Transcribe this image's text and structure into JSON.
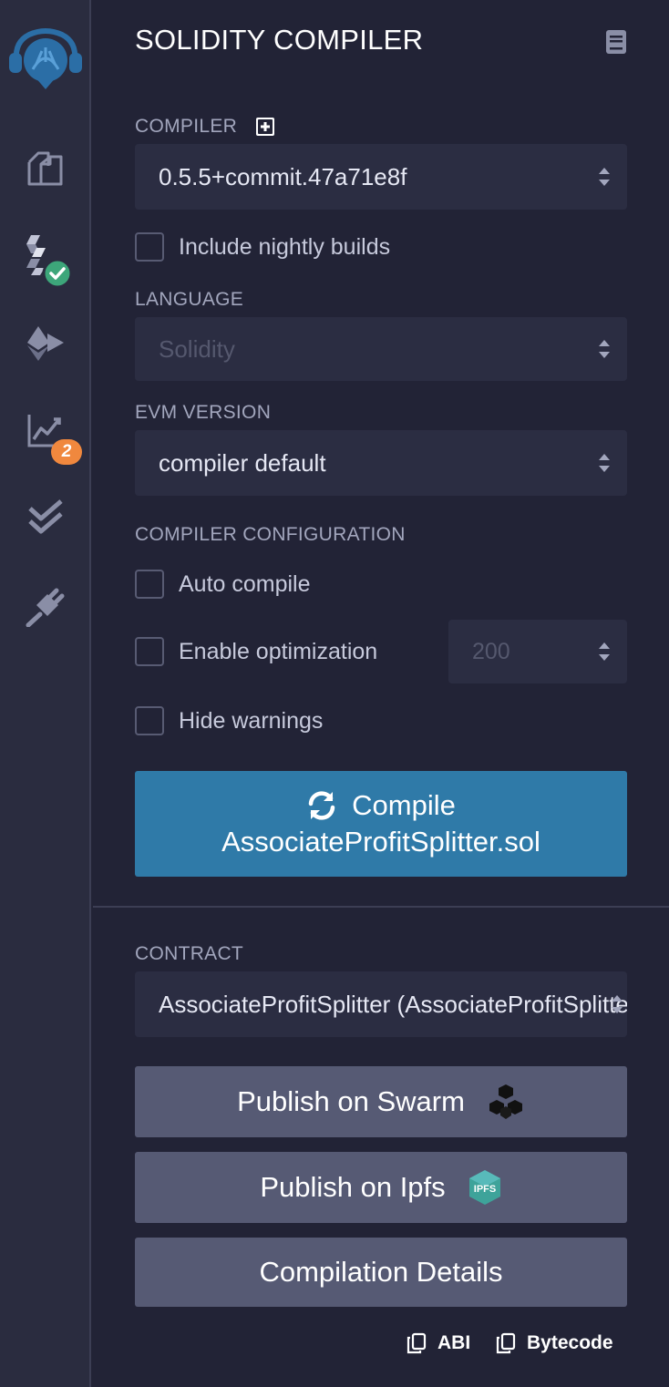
{
  "title": "SOLIDITY COMPILER",
  "compiler": {
    "label": "COMPILER",
    "version": "0.5.5+commit.47a71e8f",
    "nightly_label": "Include nightly builds"
  },
  "language": {
    "label": "LANGUAGE",
    "value": "Solidity"
  },
  "evm": {
    "label": "EVM VERSION",
    "value": "compiler default"
  },
  "config": {
    "label": "COMPILER CONFIGURATION",
    "auto_compile": "Auto compile",
    "optimization": "Enable optimization",
    "runs": "200",
    "hide_warnings": "Hide warnings"
  },
  "compile_button": {
    "line1": "Compile",
    "line2": "AssociateProfitSplitter.sol"
  },
  "contract": {
    "label": "CONTRACT",
    "value": "AssociateProfitSplitter (AssociateProfitSplitter.sol)"
  },
  "buttons": {
    "swarm": "Publish on Swarm",
    "ipfs": "Publish on Ipfs",
    "details": "Compilation Details",
    "ipfs_logo_text": "IPFS"
  },
  "copy": {
    "abi": "ABI",
    "bytecode": "Bytecode"
  },
  "sidebar": {
    "analysis_badge": "2"
  },
  "colors": {
    "accent": "#2f7aa8",
    "badge": "#f0883e",
    "success": "#3da67a"
  }
}
